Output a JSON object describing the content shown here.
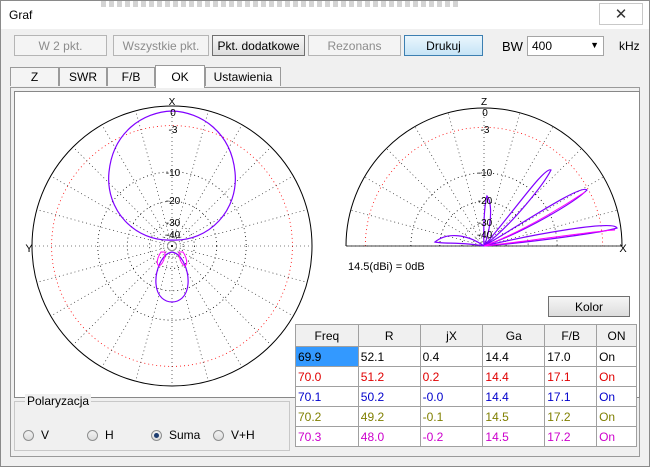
{
  "window": {
    "title": "Graf",
    "close_glyph": "✕"
  },
  "toolbar": {
    "buttons": [
      {
        "label": "W 2 pkt.",
        "state": "disabled"
      },
      {
        "label": "Wszystkie pkt.",
        "state": "disabled"
      },
      {
        "label": "Pkt. dodatkowe",
        "state": "active"
      },
      {
        "label": "Rezonans",
        "state": "disabled"
      },
      {
        "label": "Drukuj",
        "state": "primary"
      }
    ],
    "bw_label": "BW",
    "bw_value": "400",
    "bw_unit": "kHz"
  },
  "tabs": [
    {
      "label": "Z",
      "selected": false
    },
    {
      "label": "SWR",
      "selected": false
    },
    {
      "label": "F/B",
      "selected": false
    },
    {
      "label": "OK",
      "selected": true
    },
    {
      "label": "Ustawienia",
      "selected": false
    }
  ],
  "plot": {
    "azimuth": {
      "axis_top": "X",
      "axis_left": "Y",
      "rings": [
        "0",
        "-3",
        "-10",
        "-20",
        "-30",
        "-40"
      ]
    },
    "elevation": {
      "axis_top": "Z",
      "axis_right": "X",
      "rings": [
        "0",
        "-3",
        "-10",
        "-20",
        "-30",
        "-40"
      ]
    },
    "gain_ref": "14.5(dBi) = 0dB",
    "colors": {
      "grid": "#000000",
      "ref_ring": "#ff0000",
      "trace_a": "#8000ff",
      "trace_b": "#ff00ff"
    }
  },
  "kolor_label": "Kolor",
  "table": {
    "headers": [
      "Freq",
      "R",
      "jX",
      "Ga",
      "F/B",
      "ON"
    ],
    "rows": [
      {
        "cells": [
          "69.9",
          "52.1",
          "0.4",
          "14.4",
          "17.0",
          "On"
        ],
        "color": "#000000",
        "selected_first": true
      },
      {
        "cells": [
          "70.0",
          "51.2",
          "0.2",
          "14.4",
          "17.1",
          "On"
        ],
        "color": "#e00000",
        "selected_first": false
      },
      {
        "cells": [
          "70.1",
          "50.2",
          "-0.0",
          "14.4",
          "17.1",
          "On"
        ],
        "color": "#0000cc",
        "selected_first": false
      },
      {
        "cells": [
          "70.2",
          "49.2",
          "-0.1",
          "14.5",
          "17.2",
          "On"
        ],
        "color": "#808000",
        "selected_first": false
      },
      {
        "cells": [
          "70.3",
          "48.0",
          "-0.2",
          "14.5",
          "17.2",
          "On"
        ],
        "color": "#cc00cc",
        "selected_first": false
      }
    ]
  },
  "polarization": {
    "title": "Polaryzacja",
    "options": [
      {
        "label": "V",
        "checked": false
      },
      {
        "label": "H",
        "checked": false
      },
      {
        "label": "Suma",
        "checked": true
      },
      {
        "label": "V+H",
        "checked": false
      }
    ]
  }
}
